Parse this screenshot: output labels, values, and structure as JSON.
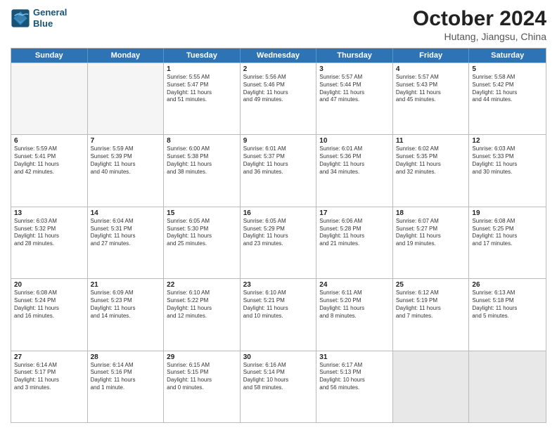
{
  "header": {
    "logo_line1": "General",
    "logo_line2": "Blue",
    "month": "October 2024",
    "location": "Hutang, Jiangsu, China"
  },
  "weekdays": [
    "Sunday",
    "Monday",
    "Tuesday",
    "Wednesday",
    "Thursday",
    "Friday",
    "Saturday"
  ],
  "rows": [
    [
      {
        "day": "",
        "text": "",
        "empty": true
      },
      {
        "day": "",
        "text": "",
        "empty": true
      },
      {
        "day": "1",
        "text": "Sunrise: 5:55 AM\nSunset: 5:47 PM\nDaylight: 11 hours\nand 51 minutes."
      },
      {
        "day": "2",
        "text": "Sunrise: 5:56 AM\nSunset: 5:46 PM\nDaylight: 11 hours\nand 49 minutes."
      },
      {
        "day": "3",
        "text": "Sunrise: 5:57 AM\nSunset: 5:44 PM\nDaylight: 11 hours\nand 47 minutes."
      },
      {
        "day": "4",
        "text": "Sunrise: 5:57 AM\nSunset: 5:43 PM\nDaylight: 11 hours\nand 45 minutes."
      },
      {
        "day": "5",
        "text": "Sunrise: 5:58 AM\nSunset: 5:42 PM\nDaylight: 11 hours\nand 44 minutes."
      }
    ],
    [
      {
        "day": "6",
        "text": "Sunrise: 5:59 AM\nSunset: 5:41 PM\nDaylight: 11 hours\nand 42 minutes."
      },
      {
        "day": "7",
        "text": "Sunrise: 5:59 AM\nSunset: 5:39 PM\nDaylight: 11 hours\nand 40 minutes."
      },
      {
        "day": "8",
        "text": "Sunrise: 6:00 AM\nSunset: 5:38 PM\nDaylight: 11 hours\nand 38 minutes."
      },
      {
        "day": "9",
        "text": "Sunrise: 6:01 AM\nSunset: 5:37 PM\nDaylight: 11 hours\nand 36 minutes."
      },
      {
        "day": "10",
        "text": "Sunrise: 6:01 AM\nSunset: 5:36 PM\nDaylight: 11 hours\nand 34 minutes."
      },
      {
        "day": "11",
        "text": "Sunrise: 6:02 AM\nSunset: 5:35 PM\nDaylight: 11 hours\nand 32 minutes."
      },
      {
        "day": "12",
        "text": "Sunrise: 6:03 AM\nSunset: 5:33 PM\nDaylight: 11 hours\nand 30 minutes."
      }
    ],
    [
      {
        "day": "13",
        "text": "Sunrise: 6:03 AM\nSunset: 5:32 PM\nDaylight: 11 hours\nand 28 minutes."
      },
      {
        "day": "14",
        "text": "Sunrise: 6:04 AM\nSunset: 5:31 PM\nDaylight: 11 hours\nand 27 minutes."
      },
      {
        "day": "15",
        "text": "Sunrise: 6:05 AM\nSunset: 5:30 PM\nDaylight: 11 hours\nand 25 minutes."
      },
      {
        "day": "16",
        "text": "Sunrise: 6:05 AM\nSunset: 5:29 PM\nDaylight: 11 hours\nand 23 minutes."
      },
      {
        "day": "17",
        "text": "Sunrise: 6:06 AM\nSunset: 5:28 PM\nDaylight: 11 hours\nand 21 minutes."
      },
      {
        "day": "18",
        "text": "Sunrise: 6:07 AM\nSunset: 5:27 PM\nDaylight: 11 hours\nand 19 minutes."
      },
      {
        "day": "19",
        "text": "Sunrise: 6:08 AM\nSunset: 5:25 PM\nDaylight: 11 hours\nand 17 minutes."
      }
    ],
    [
      {
        "day": "20",
        "text": "Sunrise: 6:08 AM\nSunset: 5:24 PM\nDaylight: 11 hours\nand 16 minutes."
      },
      {
        "day": "21",
        "text": "Sunrise: 6:09 AM\nSunset: 5:23 PM\nDaylight: 11 hours\nand 14 minutes."
      },
      {
        "day": "22",
        "text": "Sunrise: 6:10 AM\nSunset: 5:22 PM\nDaylight: 11 hours\nand 12 minutes."
      },
      {
        "day": "23",
        "text": "Sunrise: 6:10 AM\nSunset: 5:21 PM\nDaylight: 11 hours\nand 10 minutes."
      },
      {
        "day": "24",
        "text": "Sunrise: 6:11 AM\nSunset: 5:20 PM\nDaylight: 11 hours\nand 8 minutes."
      },
      {
        "day": "25",
        "text": "Sunrise: 6:12 AM\nSunset: 5:19 PM\nDaylight: 11 hours\nand 7 minutes."
      },
      {
        "day": "26",
        "text": "Sunrise: 6:13 AM\nSunset: 5:18 PM\nDaylight: 11 hours\nand 5 minutes."
      }
    ],
    [
      {
        "day": "27",
        "text": "Sunrise: 6:14 AM\nSunset: 5:17 PM\nDaylight: 11 hours\nand 3 minutes."
      },
      {
        "day": "28",
        "text": "Sunrise: 6:14 AM\nSunset: 5:16 PM\nDaylight: 11 hours\nand 1 minute."
      },
      {
        "day": "29",
        "text": "Sunrise: 6:15 AM\nSunset: 5:15 PM\nDaylight: 11 hours\nand 0 minutes."
      },
      {
        "day": "30",
        "text": "Sunrise: 6:16 AM\nSunset: 5:14 PM\nDaylight: 10 hours\nand 58 minutes."
      },
      {
        "day": "31",
        "text": "Sunrise: 6:17 AM\nSunset: 5:13 PM\nDaylight: 10 hours\nand 56 minutes."
      },
      {
        "day": "",
        "text": "",
        "empty": true,
        "shaded": true
      },
      {
        "day": "",
        "text": "",
        "empty": true,
        "shaded": true
      }
    ]
  ]
}
